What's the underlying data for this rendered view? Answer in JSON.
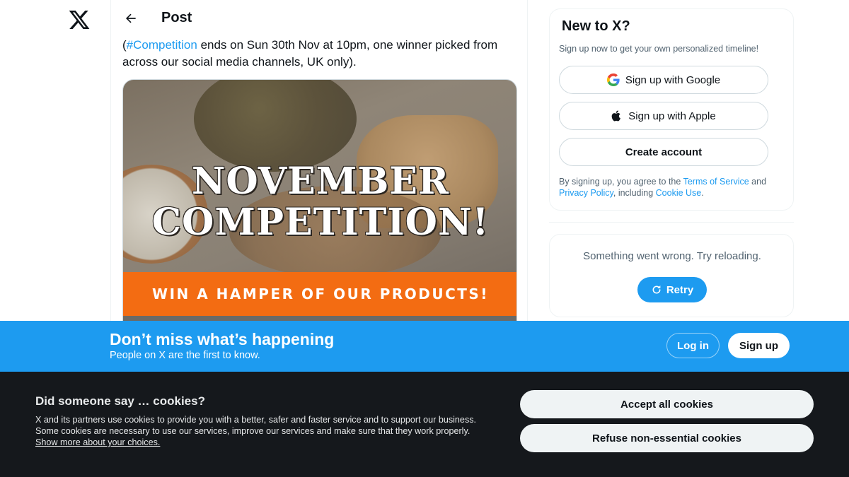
{
  "nav": {
    "logo_icon": "x-logo-icon",
    "back_icon": "arrow-left-icon"
  },
  "post": {
    "title": "Post",
    "text_hashtag": "#Competition",
    "text_pre": "(",
    "text_rest": " ends on Sun 30th Nov at 10pm, one winner picked from across our social media channels, UK only).",
    "image": {
      "headline_line1": "NOVEMBER",
      "headline_line2": "COMPETITION!",
      "band_text": "WIN A HAMPER OF OUR PRODUCTS!"
    }
  },
  "signup_card": {
    "title": "New to X?",
    "subtitle": "Sign up now to get your own personalized timeline!",
    "google_label": "Sign up with Google",
    "apple_label": "Sign up with Apple",
    "create_label": "Create account",
    "legal_pre": "By signing up, you agree to the ",
    "terms_link": "Terms of Service",
    "legal_and": " and ",
    "privacy_link": "Privacy Policy",
    "legal_including": ", including ",
    "cookie_link": "Cookie Use",
    "legal_end": "."
  },
  "error_card": {
    "message": "Something went wrong. Try reloading.",
    "retry_label": "Retry"
  },
  "bottom_bar": {
    "title": "Don’t miss what’s happening",
    "subtitle": "People on X are the first to know.",
    "login_label": "Log in",
    "signup_label": "Sign up"
  },
  "cookie_banner": {
    "title": "Did someone say … cookies?",
    "body": "X and its partners use cookies to provide you with a better, safer and faster service and to support our business. Some cookies are necessary to use our services, improve our services and make sure that they work properly. ",
    "link": "Show more about your choices.",
    "accept_label": "Accept all cookies",
    "refuse_label": "Refuse non-essential cookies"
  },
  "colors": {
    "accent": "#1d9bf0",
    "cookie_bg": "#15181c",
    "band_orange": "#f36c12"
  }
}
